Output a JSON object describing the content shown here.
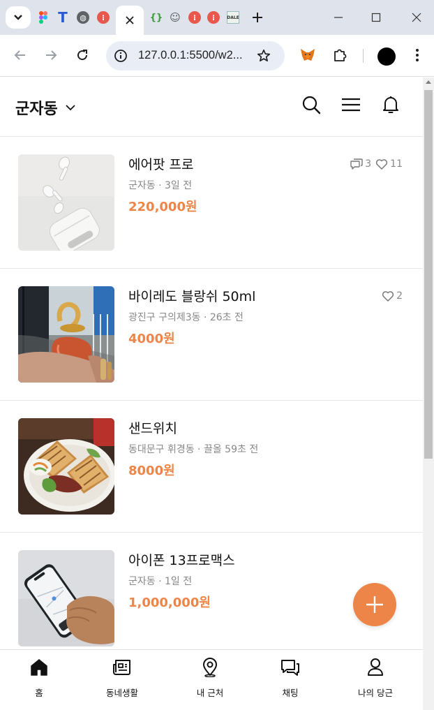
{
  "browser": {
    "url": "127.0.0.1:5500/w2...",
    "colors": {
      "tabbar": "#dfe3eb",
      "omnibox": "#e9edf5"
    },
    "favicons": [
      "figma-icon",
      "t-icon",
      "globe-icon",
      "red-app-icon",
      "braces-icon",
      "ghost-icon",
      "red-app-icon",
      "red-app-icon",
      "dale-icon"
    ]
  },
  "app": {
    "location": "군자동",
    "accent_color": "#ee8548",
    "products": [
      {
        "title": "에어팟 프로",
        "meta": "군자동 · 3일 전",
        "price": "220,000원",
        "chats": "3",
        "likes": "11",
        "image": "airpods-photo"
      },
      {
        "title": "바이레도 블랑쉬 50ml",
        "meta": "광진구 구의제3동 · 26초 전",
        "price": "4000원",
        "likes": "2",
        "image": "perfume-photo"
      },
      {
        "title": "샌드위치",
        "meta": "동대문구 휘경동 · 끌올 59초 전",
        "price": "8000원",
        "image": "sandwich-photo"
      },
      {
        "title": "아이폰 13프로맥스",
        "meta": "군자동 · 1일 전",
        "price": "1,000,000원",
        "image": "iphone-photo"
      }
    ],
    "bottom_nav": [
      {
        "label": "홈",
        "icon": "home-icon"
      },
      {
        "label": "동네생활",
        "icon": "newspaper-icon"
      },
      {
        "label": "내 근처",
        "icon": "location-pin-icon"
      },
      {
        "label": "채팅",
        "icon": "chat-icon"
      },
      {
        "label": "나의 당근",
        "icon": "person-icon"
      }
    ]
  }
}
